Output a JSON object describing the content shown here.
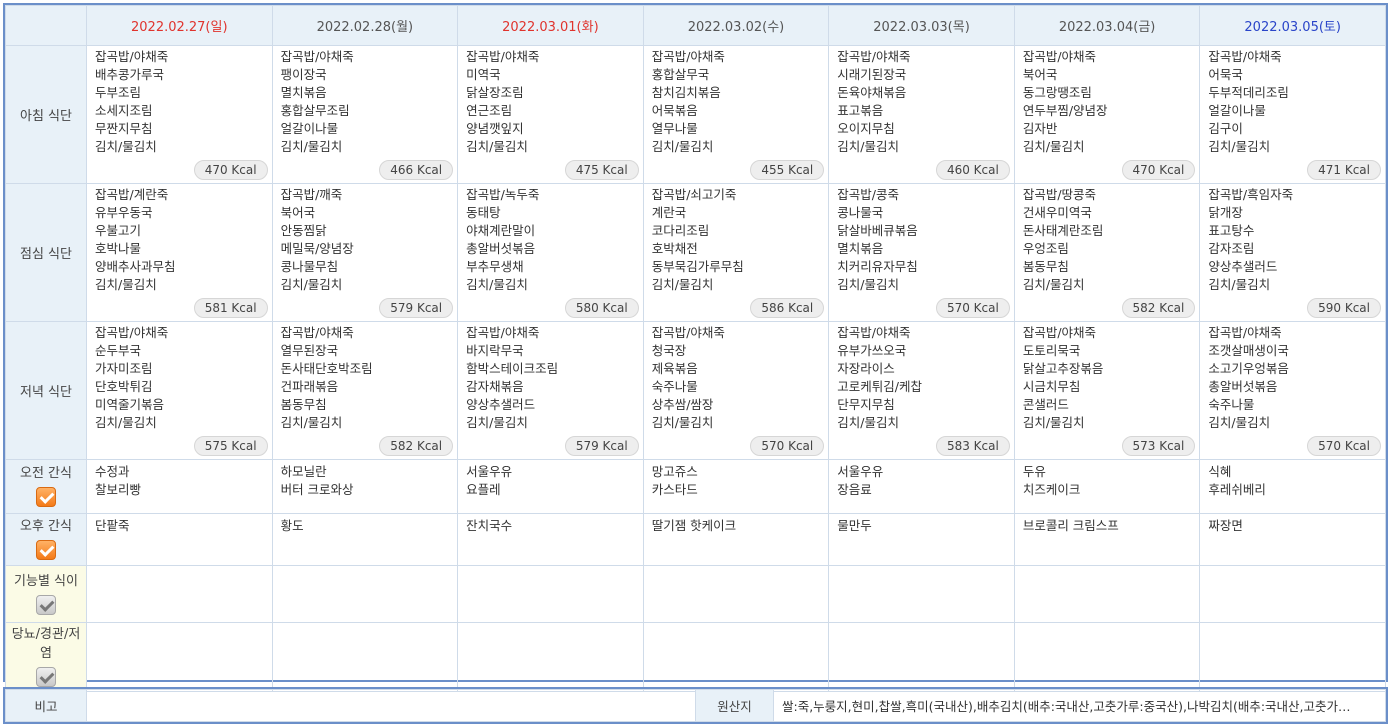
{
  "days": [
    {
      "date": "2022.02.27(일)",
      "type": "sun"
    },
    {
      "date": "2022.02.28(월)",
      "type": "weekday"
    },
    {
      "date": "2022.03.01(화)",
      "type": "holiday"
    },
    {
      "date": "2022.03.02(수)",
      "type": "weekday"
    },
    {
      "date": "2022.03.03(목)",
      "type": "weekday"
    },
    {
      "date": "2022.03.04(금)",
      "type": "weekday"
    },
    {
      "date": "2022.03.05(토)",
      "type": "sat"
    }
  ],
  "colors": {
    "sunday": "#e0332d",
    "saturday": "#2a45c9",
    "header_bg": "#e8f1f8",
    "border": "#6b8fc9",
    "check_orange": "#f47a18"
  },
  "row_labels": {
    "breakfast": "아침 식단",
    "lunch": "점심 식단",
    "dinner": "저녁 식단",
    "am_snack": "오전 간식",
    "pm_snack": "오후 간식",
    "functional": "기능별 식이",
    "diabetes": "당뇨/경관/저염"
  },
  "breakfast": [
    {
      "items": [
        "잡곡밥/야채죽",
        "배추콩가루국",
        "두부조림",
        "소세지조림",
        "무짠지무침",
        "김치/물김치"
      ],
      "kcal": "470 Kcal"
    },
    {
      "items": [
        "잡곡밥/야채죽",
        "팽이장국",
        "멸치볶음",
        "홍합살무조림",
        "얼갈이나물",
        "김치/물김치"
      ],
      "kcal": "466 Kcal"
    },
    {
      "items": [
        "잡곡밥/야채죽",
        "미역국",
        "닭살장조림",
        "연근조림",
        "양념깻잎지",
        "김치/물김치"
      ],
      "kcal": "475 Kcal"
    },
    {
      "items": [
        "잡곡밥/야채죽",
        "홍합살무국",
        "참치김치볶음",
        "어묵볶음",
        "열무나물",
        "김치/물김치"
      ],
      "kcal": "455 Kcal"
    },
    {
      "items": [
        "잡곡밥/야채죽",
        "시래기된장국",
        "돈육야채볶음",
        "표고볶음",
        "오이지무침",
        "김치/물김치"
      ],
      "kcal": "460 Kcal"
    },
    {
      "items": [
        "잡곡밥/야채죽",
        "북어국",
        "동그랑땡조림",
        "연두부찜/양념장",
        "김자반",
        "김치/물김치"
      ],
      "kcal": "470 Kcal"
    },
    {
      "items": [
        "잡곡밥/야채죽",
        "어묵국",
        "두부적데리조림",
        "얼갈이나물",
        "김구이",
        "김치/물김치"
      ],
      "kcal": "471 Kcal"
    }
  ],
  "lunch": [
    {
      "items": [
        "잡곡밥/계란죽",
        "유부우동국",
        "우불고기",
        "호박나물",
        "양배추사과무침",
        "김치/물김치"
      ],
      "kcal": "581 Kcal"
    },
    {
      "items": [
        "잡곡밥/깨죽",
        "북어국",
        "안동찜닭",
        "메밀묵/양념장",
        "콩나물무침",
        "김치/물김치"
      ],
      "kcal": "579 Kcal"
    },
    {
      "items": [
        "잡곡밥/녹두죽",
        "동태탕",
        "야채계란말이",
        "총알버섯볶음",
        "부추무생채",
        "김치/물김치"
      ],
      "kcal": "580 Kcal"
    },
    {
      "items": [
        "잡곡밥/쇠고기죽",
        "계란국",
        "코다리조림",
        "호박채전",
        "동부묵김가루무침",
        "김치/물김치"
      ],
      "kcal": "586 Kcal"
    },
    {
      "items": [
        "잡곡밥/콩죽",
        "콩나물국",
        "닭살바베큐볶음",
        "멸치볶음",
        "치커리유자무침",
        "김치/물김치"
      ],
      "kcal": "570 Kcal"
    },
    {
      "items": [
        "잡곡밥/땅콩죽",
        "건새우미역국",
        "돈사태계란조림",
        "우엉조림",
        "봄동무침",
        "김치/물김치"
      ],
      "kcal": "582 Kcal"
    },
    {
      "items": [
        "잡곡밥/흑임자죽",
        "닭개장",
        "표고탕수",
        "감자조림",
        "양상추샐러드",
        "김치/물김치"
      ],
      "kcal": "590 Kcal"
    }
  ],
  "dinner": [
    {
      "items": [
        "잡곡밥/야채죽",
        "순두부국",
        "가자미조림",
        "단호박튀김",
        "미역줄기볶음",
        "김치/물김치"
      ],
      "kcal": "575 Kcal"
    },
    {
      "items": [
        "잡곡밥/야채죽",
        "열무된장국",
        "돈사태단호박조림",
        "건파래볶음",
        "봄동무침",
        "김치/물김치"
      ],
      "kcal": "582 Kcal"
    },
    {
      "items": [
        "잡곡밥/야채죽",
        "바지락무국",
        "함박스테이크조림",
        "감자채볶음",
        "양상추샐러드",
        "김치/물김치"
      ],
      "kcal": "579 Kcal"
    },
    {
      "items": [
        "잡곡밥/야채죽",
        "청국장",
        "제육볶음",
        "숙주나물",
        "상추쌈/쌈장",
        "김치/물김치"
      ],
      "kcal": "570 Kcal"
    },
    {
      "items": [
        "잡곡밥/야채죽",
        "유부가쓰오국",
        "자장라이스",
        "고로케튀김/케찹",
        "단무지무침",
        "김치/물김치"
      ],
      "kcal": "583 Kcal"
    },
    {
      "items": [
        "잡곡밥/야채죽",
        "도토리묵국",
        "닭살고추장볶음",
        "시금치무침",
        "콘샐러드",
        "김치/물김치"
      ],
      "kcal": "573 Kcal"
    },
    {
      "items": [
        "잡곡밥/야채죽",
        "조갯살매생이국",
        "소고기우엉볶음",
        "총알버섯볶음",
        "숙주나물",
        "김치/물김치"
      ],
      "kcal": "570 Kcal"
    }
  ],
  "am_snack": [
    [
      "수정과",
      "찰보리빵"
    ],
    [
      "하모닐란",
      "버터 크로와상"
    ],
    [
      "서울우유",
      "요플레"
    ],
    [
      "망고쥬스",
      "카스타드"
    ],
    [
      "서울우유",
      "장음료"
    ],
    [
      "두유",
      "치즈케이크"
    ],
    [
      "식혜",
      "후레쉬베리"
    ]
  ],
  "pm_snack": [
    [
      "단팥죽"
    ],
    [
      "황도"
    ],
    [
      "잔치국수"
    ],
    [
      "딸기잼 핫케이크"
    ],
    [
      "물만두"
    ],
    [
      "브로콜리 크림스프"
    ],
    [
      "짜장면"
    ]
  ],
  "footer": {
    "note_label": "비고",
    "note_value": "",
    "origin_label": "원산지",
    "origin_text": "쌀:죽,누룽지,현미,찹쌀,흑미(국내산),배추김치(배추:국내산,고춧가루:중국산),나박김치(배추:국내산,고춧가…"
  }
}
